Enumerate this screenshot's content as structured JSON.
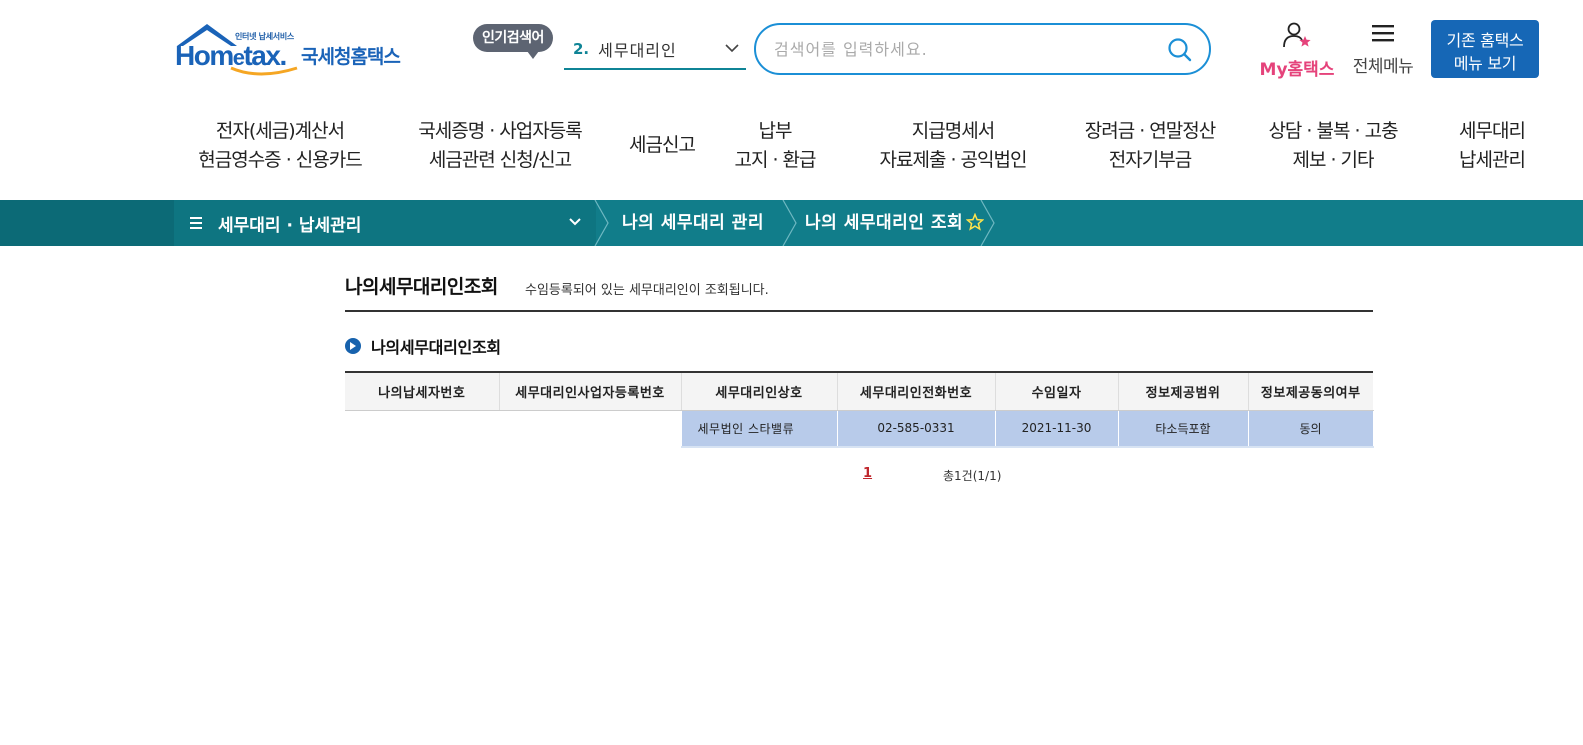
{
  "header": {
    "logo": {
      "tagline": "인터넷 납세서비스",
      "wordmark_pre": "Hom",
      "wordmark_e": "e",
      "wordmark_post": "tax.",
      "name": "국세청홈택스"
    },
    "popular_label": "인기검색어",
    "popular_keyword": {
      "rank": "2.",
      "text": "세무대리인"
    },
    "search": {
      "placeholder": "검색어를 입력하세요.",
      "value": ""
    },
    "my_hometax": "My홈택스",
    "all_menu": "전체메뉴",
    "old_menu_button": {
      "line1": "기존 홈택스",
      "line2": "메뉴 보기"
    }
  },
  "main_nav": [
    {
      "line1": "전자(세금)계산서",
      "line2": "현금영수증 · 신용카드"
    },
    {
      "line1": "국세증명 · 사업자등록",
      "line2": "세금관련 신청/신고"
    },
    {
      "line1": "세금신고",
      "line2": ""
    },
    {
      "line1": "납부",
      "line2": "고지 · 환급"
    },
    {
      "line1": "지급명세서",
      "line2": "자료제출 · 공익법인"
    },
    {
      "line1": "장려금 · 연말정산",
      "line2": "전자기부금"
    },
    {
      "line1": "상담 · 불복 · 고충",
      "line2": "제보 · 기타"
    },
    {
      "line1": "세무대리",
      "line2": "납세관리"
    }
  ],
  "breadcrumb": {
    "section": "세무대리 · 납세관리",
    "level1": "나의 세무대리 관리",
    "level2": "나의 세무대리인 조회"
  },
  "page": {
    "title": "나의세무대리인조회",
    "description": "수임등록되어 있는 세무대리인이 조회됩니다.",
    "section_title": "나의세무대리인조회"
  },
  "table": {
    "headers": [
      "나의납세자번호",
      "세무대리인사업자등록번호",
      "세무대리인상호",
      "세무대리인전화번호",
      "수임일자",
      "정보제공범위",
      "정보제공동의여부"
    ],
    "rows": [
      {
        "taxpayer_no": "",
        "biz_reg_no": "",
        "name": "세무법인 스타밸류",
        "phone": "02-585-0331",
        "date": "2021-11-30",
        "scope": "타소득포함",
        "consent": "동의"
      }
    ]
  },
  "pagination": {
    "current": "1",
    "total": "총1건(1/1)"
  },
  "colors": {
    "brand_blue": "#1a63b8",
    "teal": "#117d8a",
    "accent_pink": "#e5437b",
    "selected_row": "#b8cbea"
  }
}
